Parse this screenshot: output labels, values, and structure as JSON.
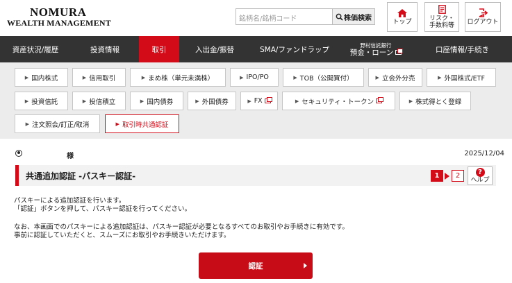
{
  "header": {
    "logo_line1": "NOMURA",
    "logo_line2": "WEALTH MANAGEMENT",
    "search_placeholder": "銘柄名/銘柄コード",
    "search_button": "株価検索",
    "buttons": [
      {
        "label": "トップ",
        "icon": "home-icon"
      },
      {
        "label": "リスク・\n手数料等",
        "icon": "document-icon"
      },
      {
        "label": "ログアウト",
        "icon": "logout-icon"
      }
    ]
  },
  "nav": {
    "items": [
      {
        "label": "資産状況/履歴"
      },
      {
        "label": "投資情報"
      },
      {
        "label": "取引",
        "active": true
      },
      {
        "label": "入出金/振替"
      },
      {
        "label": "SMA/ファンドラップ"
      },
      {
        "label_small": "野村信託銀行",
        "label": "預金・ローン"
      },
      {
        "label": "口座情報/手続き"
      }
    ]
  },
  "subnav": {
    "items": [
      {
        "label": "国内株式"
      },
      {
        "label": "信用取引"
      },
      {
        "label": "まめ株（単元未満株）"
      },
      {
        "label": "IPO/PO"
      },
      {
        "label": "TOB（公開買付）"
      },
      {
        "label": "立会外分売"
      },
      {
        "label": "外国株式/ETF"
      },
      {
        "label": "投資信託"
      },
      {
        "label": "投信積立"
      },
      {
        "label": "国内債券"
      },
      {
        "label": "外国債券"
      },
      {
        "label": "FX"
      },
      {
        "label": "セキュリティ・トークン"
      },
      {
        "label": "株式得とく登録"
      },
      {
        "label": "注文照会/訂正/取消"
      },
      {
        "label": "取引時共通認証",
        "active": true
      }
    ]
  },
  "content": {
    "user_suffix": "様",
    "date": "2025/12/04",
    "title": "共通追加認証 -パスキー認証-",
    "steps": [
      "1",
      "2"
    ],
    "help_label": "ヘルプ",
    "para1_line1": "パスキーによる追加認証を行います。",
    "para1_line2": "「認証」ボタンを押して、パスキー認証を行ってください。",
    "para2_line1": "なお、本画面でのパスキーによる追加認証は、パスキー認証が必要となるすべてのお取引やお手続きに有効です。",
    "para2_line2": "事前に認証していただくと、スムーズにお取引やお手続きいただけます。",
    "auth_button": "認証"
  },
  "colors": {
    "accent": "#d30b18",
    "nav_bg": "#333333",
    "subnav_bg": "#ececec"
  }
}
